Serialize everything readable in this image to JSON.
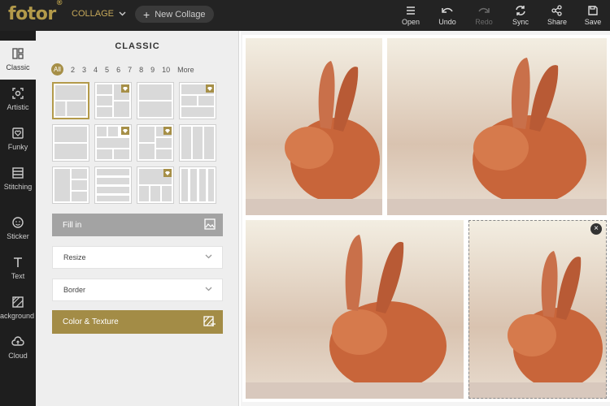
{
  "header": {
    "logo": "fotor",
    "logo_mark": "®",
    "collage_menu": "COLLAGE",
    "new_collage": "New Collage",
    "actions": [
      {
        "label": "Open",
        "icon": "open-icon",
        "enabled": true
      },
      {
        "label": "Undo",
        "icon": "undo-icon",
        "enabled": true
      },
      {
        "label": "Redo",
        "icon": "redo-icon",
        "enabled": false
      },
      {
        "label": "Sync",
        "icon": "sync-icon",
        "enabled": true
      },
      {
        "label": "Share",
        "icon": "share-icon",
        "enabled": true
      },
      {
        "label": "Save",
        "icon": "save-icon",
        "enabled": true
      }
    ]
  },
  "rail": {
    "items": [
      {
        "label": "Classic",
        "icon": "classic-layout-icon",
        "active": true
      },
      {
        "label": "Artistic",
        "icon": "artistic-icon",
        "active": false
      },
      {
        "label": "Funky",
        "icon": "funky-heart-icon",
        "active": false
      },
      {
        "label": "Stitching",
        "icon": "stitching-icon",
        "active": false
      },
      {
        "label": "Sticker",
        "icon": "sticker-icon",
        "active": false
      },
      {
        "label": "Text",
        "icon": "text-icon",
        "active": false
      },
      {
        "label": "Background",
        "icon": "background-icon",
        "active": false
      },
      {
        "label": "Cloud",
        "icon": "cloud-icon",
        "active": false
      }
    ]
  },
  "panel": {
    "title": "CLASSIC",
    "filters": [
      "All",
      "2",
      "3",
      "4",
      "5",
      "6",
      "7",
      "8",
      "9",
      "10",
      "More"
    ],
    "selected_filter": "All",
    "fill_in": "Fill in",
    "resize": "Resize",
    "border": "Border",
    "color_texture": "Color & Texture"
  },
  "colors": {
    "accent": "#a68f47",
    "topbar": "#232323",
    "rail": "#1e1e1e",
    "panel": "#eeeeee"
  }
}
